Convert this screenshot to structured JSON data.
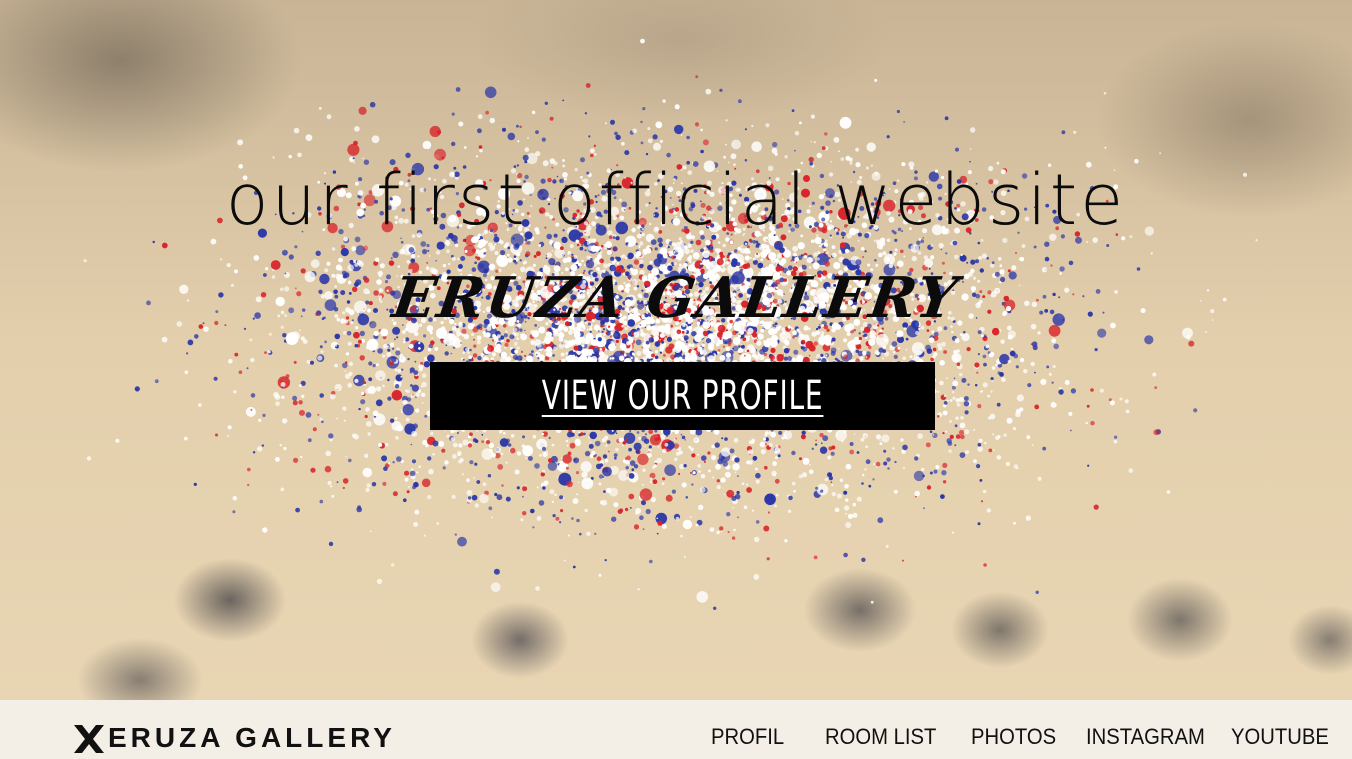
{
  "hero": {
    "tagline": "our first official website",
    "brand_title": "ERUZA GALLERY",
    "cta_label": "VIEW OUR PROFILE"
  },
  "nav": {
    "logo_text": "ERUZA GALLERY",
    "logo_icon": "x-logo-icon",
    "items": [
      {
        "label": "PROFIL"
      },
      {
        "label": "ROOM LIST"
      },
      {
        "label": "PHOTOS"
      },
      {
        "label": "INSTAGRAM"
      },
      {
        "label": "YOUTUBE"
      }
    ]
  },
  "colors": {
    "splash_red": "#d8232a",
    "splash_blue": "#2b37a8",
    "splash_white": "#ffffff",
    "cta_background": "#000000",
    "navbar_background": "#f3eee6"
  }
}
